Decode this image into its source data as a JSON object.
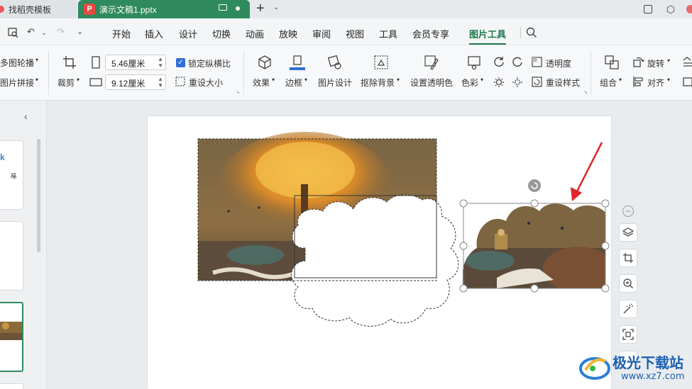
{
  "titlebar": {
    "tab_inactive_label": "找稻壳模板",
    "tab_active_badge": "P",
    "tab_active_label": "演示文稿1.pptx",
    "new_tab": "+",
    "tabs_chevron": "⌄"
  },
  "quick_access": {
    "print_preview_icon": "print-preview-icon",
    "undo": "↶",
    "redo": "↷",
    "more": "⌄"
  },
  "menu": {
    "items": [
      "开始",
      "插入",
      "设计",
      "切换",
      "动画",
      "放映",
      "审阅",
      "视图",
      "工具",
      "会员专享",
      "图片工具"
    ],
    "active": "图片工具",
    "search_icon": "search-icon"
  },
  "ribbon": {
    "group_left": {
      "carousel": "多图轮播",
      "mosaic": "图片拼接"
    },
    "crop": "裁剪",
    "width_value": "5.46厘米",
    "height_value": "9.12厘米",
    "lock_ratio": "锁定纵横比",
    "reset_size": "重设大小",
    "effects": "效果",
    "border": "边框",
    "picture_design": "图片设计",
    "remove_bg": "抠除背景",
    "set_transparent": "设置透明色",
    "color": "色彩",
    "transparency": "透明度",
    "reset_style": "重设样式",
    "group": "组合",
    "rotate": "旋转",
    "align": "对齐",
    "accent_color": "#1f7a4d"
  },
  "left_panel": {
    "collapse": "‹",
    "slide1_text_a": "k",
    "slide1_text_b": "福"
  },
  "watermark": {
    "text": "极光下载站",
    "url": "www.xz7.com"
  },
  "colors": {
    "tab_active": "#2f8b5e",
    "ppt_badge": "#e8493f",
    "selection_arrow": "#e0262a"
  }
}
